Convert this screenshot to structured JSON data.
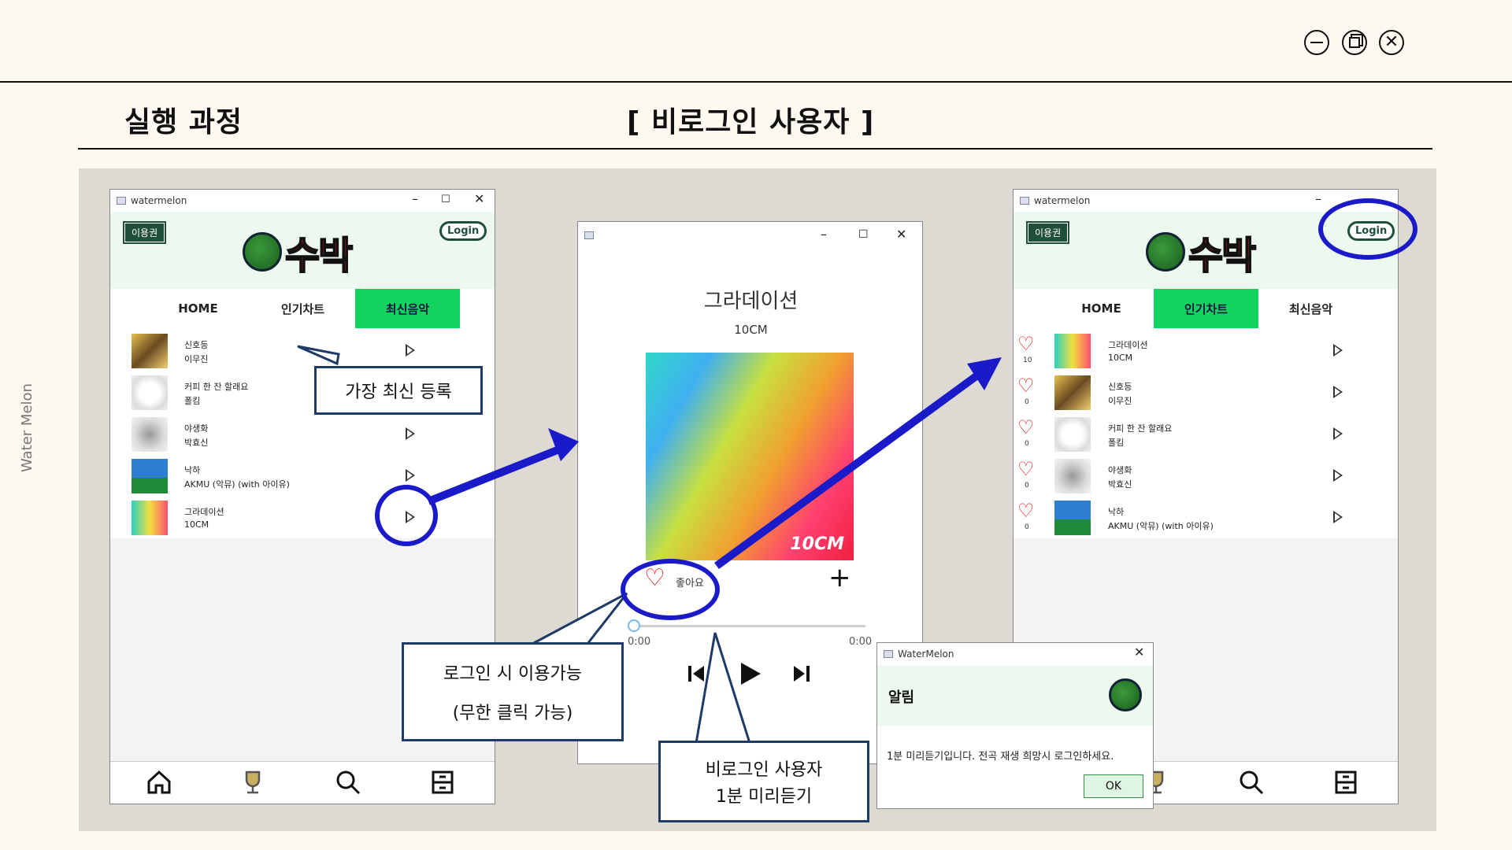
{
  "slide": {
    "title": "실행 과정",
    "subtitle": "[ 비로그인 사용자 ]",
    "side_label": "Water Melon",
    "controls": [
      "minimize-icon",
      "restore-icon",
      "close-icon"
    ]
  },
  "left_window": {
    "titlebar": "watermelon",
    "pass_label": "이용권",
    "login_label": "Login",
    "logo_text": "수박",
    "tabs": [
      "HOME",
      "인기차트",
      "최신음악"
    ],
    "active_tab": "최신음악",
    "songs": [
      {
        "title": "신호등",
        "artist": "이무진"
      },
      {
        "title": "커피 한 잔 할래요",
        "artist": "폴킴"
      },
      {
        "title": "야생화",
        "artist": "박효신"
      },
      {
        "title": "낙하",
        "artist": "AKMU (악뮤) (with 아이유)"
      },
      {
        "title": "그라데이션",
        "artist": "10CM"
      }
    ]
  },
  "player_window": {
    "song_title": "그라데이션",
    "artist": "10CM",
    "album_mark": "10CM",
    "like_label": "좋아요",
    "time_start": "0:00",
    "time_end": "0:00",
    "progress": 0.0
  },
  "right_window": {
    "titlebar": "watermelon",
    "pass_label": "이용권",
    "login_label": "Login",
    "logo_text": "수박",
    "tabs": [
      "HOME",
      "인기차트",
      "최신음악"
    ],
    "active_tab": "인기차트",
    "songs": [
      {
        "title": "그라데이션",
        "artist": "10CM",
        "likes": "10"
      },
      {
        "title": "신호등",
        "artist": "이무진",
        "likes": "0"
      },
      {
        "title": "커피 한 잔 할래요",
        "artist": "폴킴",
        "likes": "0"
      },
      {
        "title": "야생화",
        "artist": "박효신",
        "likes": "0"
      },
      {
        "title": "낙하",
        "artist": "AKMU (악뮤) (with 아이유)",
        "likes": "0"
      }
    ]
  },
  "dialog": {
    "titlebar": "WaterMelon",
    "heading": "알림",
    "message": "1분 미리듣기입니다. 전곡 재생 희망시 로그인하세요.",
    "ok_label": "OK"
  },
  "callouts": {
    "newest": "가장 최신 등록",
    "login_use_1": "로그인 시 이용가능",
    "login_use_2": "(무한 클릭 가능)",
    "guest_1": "비로그인 사용자",
    "guest_2": "1분 미리듣기"
  },
  "colors": {
    "accent_green": "#12d35d",
    "dark_green": "#1f4f3a",
    "annotation_blue": "#1a1ac8",
    "heart_red": "#e01b1b"
  }
}
